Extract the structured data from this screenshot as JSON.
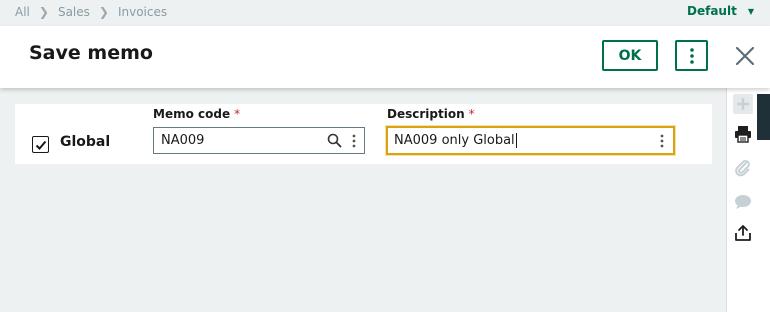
{
  "breadcrumb": [
    "All",
    "Sales",
    "Invoices"
  ],
  "header_right": {
    "default_label": "Default"
  },
  "dialog": {
    "title": "Save memo",
    "ok_label": "OK"
  },
  "form": {
    "global": {
      "label": "Global",
      "checked": true
    },
    "memo_code": {
      "label": "Memo code",
      "required_mark": "*",
      "value": "NA009"
    },
    "description": {
      "label": "Description",
      "required_mark": "*",
      "value": "NA009 only Global"
    }
  },
  "side_panel": {
    "icons": [
      "plus-icon",
      "printer-icon",
      "paperclip-icon",
      "comment-icon",
      "share-icon"
    ]
  },
  "colors": {
    "accent": "#00704a",
    "focus": "#dca311",
    "required": "#c22b2b"
  }
}
